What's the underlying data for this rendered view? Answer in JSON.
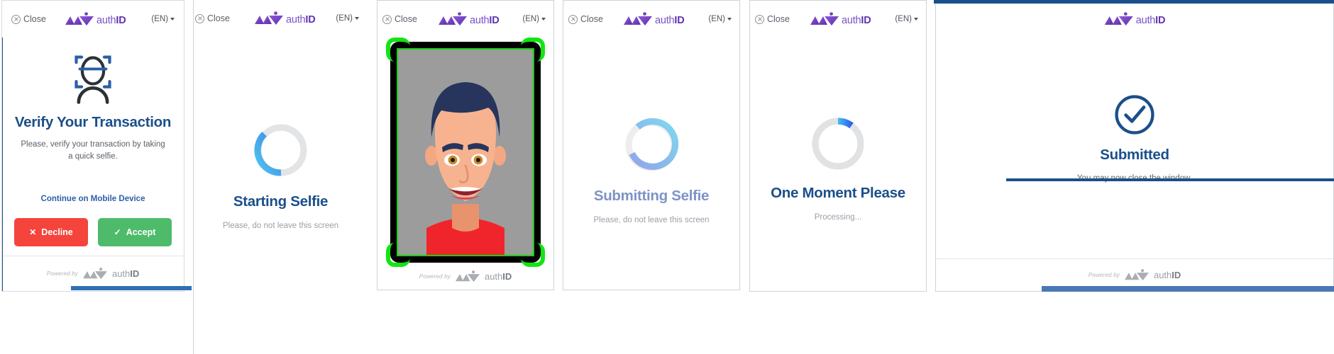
{
  "meta": {
    "brand_name_light": "auth",
    "brand_name_bold": "ID",
    "powered_by": "Powered by",
    "close_label": "Close",
    "lang_label": "(EN)",
    "accent_blue": "#1b4f8a",
    "accent_purple": "#7b52c9",
    "decline_red": "#f4443c",
    "accept_green": "#4ebb6a",
    "scan_green": "#12e512"
  },
  "panels": [
    {
      "id": "verify-transaction",
      "has_close": true,
      "has_lang": true,
      "has_footer": true,
      "title": "Verify Your Transaction",
      "subtitle": "Please, verify your transaction by taking a quick selfie.",
      "mobile_link": "Continue on Mobile Device",
      "decline_label": "Decline",
      "accept_label": "Accept"
    },
    {
      "id": "starting-selfie",
      "has_close": true,
      "has_lang": true,
      "has_footer": false,
      "title": "Starting Selfie",
      "subtitle": "Please, do not leave this screen"
    },
    {
      "id": "selfie-capture",
      "has_close": true,
      "has_lang": true,
      "has_footer": true,
      "title": "",
      "subtitle": ""
    },
    {
      "id": "submitting-selfie",
      "has_close": true,
      "has_lang": true,
      "has_footer": false,
      "title": "Submitting Selfie",
      "subtitle": "Please, do not leave this screen"
    },
    {
      "id": "one-moment-please",
      "has_close": true,
      "has_lang": true,
      "has_footer": false,
      "title": "One Moment Please",
      "subtitle": "Processing..."
    },
    {
      "id": "submitted",
      "has_close": false,
      "has_lang": false,
      "has_footer": true,
      "title": "Submitted",
      "subtitle": "You may now close the window."
    }
  ]
}
